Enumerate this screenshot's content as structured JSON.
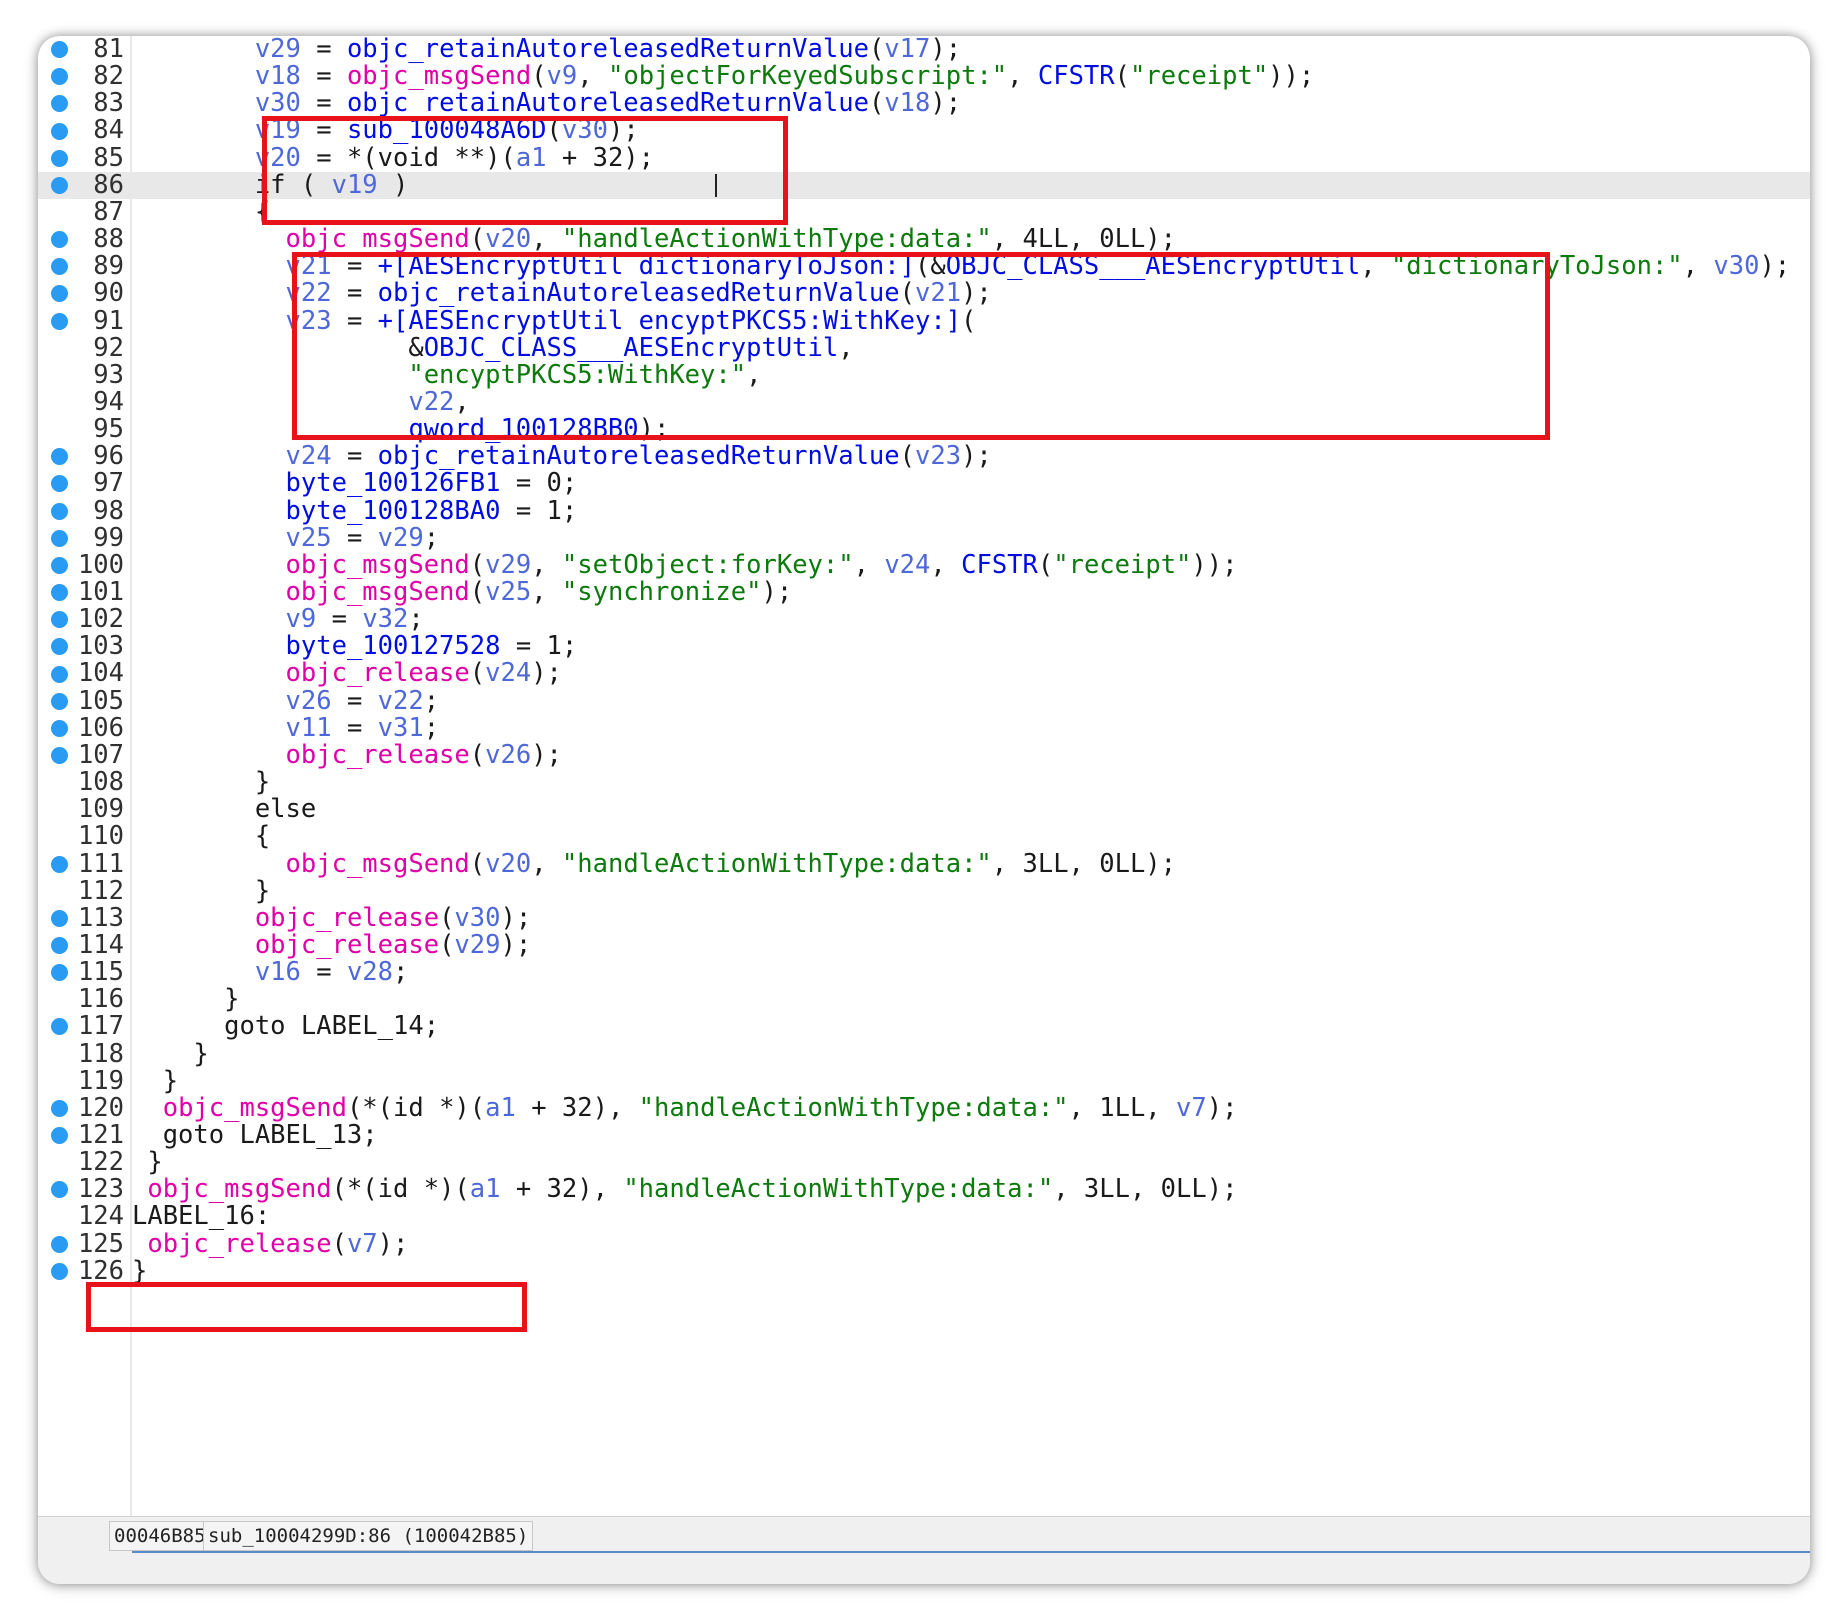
{
  "code": {
    "current_line": 86,
    "lines": [
      {
        "n": "81",
        "bp": true,
        "html": "        <span class=\"v\">v29</span> = <span class=\"f\">objc_retainAutoreleasedReturnValue</span>(<span class=\"v\">v17</span>);"
      },
      {
        "n": "82",
        "bp": true,
        "html": "        <span class=\"v\">v18</span> = <span class=\"m\">objc_msgSend</span>(<span class=\"v\">v9</span>, <span class=\"s\">\"objectForKeyedSubscript:\"</span>, <span class=\"f\">CFSTR</span>(<span class=\"s\">\"receipt\"</span>));"
      },
      {
        "n": "83",
        "bp": true,
        "html": "        <span class=\"v\">v30</span> = <span class=\"f\">objc_retainAutoreleasedReturnValue</span>(<span class=\"v\">v18</span>);"
      },
      {
        "n": "84",
        "bp": true,
        "html": "        <span class=\"v\">v19</span> = <span class=\"f\">sub_100048A6D</span>(<span class=\"v\">v30</span>);"
      },
      {
        "n": "85",
        "bp": true,
        "html": "        <span class=\"v\">v20</span> = *(void **)(<span class=\"v\">a1</span> + 32);"
      },
      {
        "n": "86",
        "bp": true,
        "html": "        if ( <span class=\"v\">v19</span> )"
      },
      {
        "n": "87",
        "bp": false,
        "html": "        {"
      },
      {
        "n": "88",
        "bp": true,
        "html": "          <span class=\"m\">objc_msgSend</span>(<span class=\"v\">v20</span>, <span class=\"s\">\"handleActionWithType:data:\"</span>, 4LL, 0LL);"
      },
      {
        "n": "89",
        "bp": true,
        "html": "          <span class=\"v\">v21</span> = <span class=\"f\">+[AESEncryptUtil dictionaryToJson:]</span>(&amp;<span class=\"f\">OBJC_CLASS___AESEncryptUtil</span>, <span class=\"s\">\"dictionaryToJson:\"</span>, <span class=\"v\">v30</span>);"
      },
      {
        "n": "90",
        "bp": true,
        "html": "          <span class=\"v\">v22</span> = <span class=\"f\">objc_retainAutoreleasedReturnValue</span>(<span class=\"v\">v21</span>);"
      },
      {
        "n": "91",
        "bp": true,
        "html": "          <span class=\"v\">v23</span> = <span class=\"f\">+[AESEncryptUtil encyptPKCS5:WithKey:]</span>("
      },
      {
        "n": "92",
        "bp": false,
        "html": "                  &amp;<span class=\"f\">OBJC_CLASS___AESEncryptUtil</span>,"
      },
      {
        "n": "93",
        "bp": false,
        "html": "                  <span class=\"s\">\"encyptPKCS5:WithKey:\"</span>,"
      },
      {
        "n": "94",
        "bp": false,
        "html": "                  <span class=\"v\">v22</span>,"
      },
      {
        "n": "95",
        "bp": false,
        "html": "                  <span class=\"f\">qword_100128BB0</span>);"
      },
      {
        "n": "96",
        "bp": true,
        "html": "          <span class=\"v\">v24</span> = <span class=\"f\">objc_retainAutoreleasedReturnValue</span>(<span class=\"v\">v23</span>);"
      },
      {
        "n": "97",
        "bp": true,
        "html": "          <span class=\"f\">byte_100126FB1</span> = 0;"
      },
      {
        "n": "98",
        "bp": true,
        "html": "          <span class=\"f\">byte_100128BA0</span> = 1;"
      },
      {
        "n": "99",
        "bp": true,
        "html": "          <span class=\"v\">v25</span> = <span class=\"v\">v29</span>;"
      },
      {
        "n": "100",
        "bp": true,
        "html": "          <span class=\"m\">objc_msgSend</span>(<span class=\"v\">v29</span>, <span class=\"s\">\"setObject:forKey:\"</span>, <span class=\"v\">v24</span>, <span class=\"f\">CFSTR</span>(<span class=\"s\">\"receipt\"</span>));"
      },
      {
        "n": "101",
        "bp": true,
        "html": "          <span class=\"m\">objc_msgSend</span>(<span class=\"v\">v25</span>, <span class=\"s\">\"synchronize\"</span>);"
      },
      {
        "n": "102",
        "bp": true,
        "html": "          <span class=\"v\">v9</span> = <span class=\"v\">v32</span>;"
      },
      {
        "n": "103",
        "bp": true,
        "html": "          <span class=\"f\">byte_100127528</span> = 1;"
      },
      {
        "n": "104",
        "bp": true,
        "html": "          <span class=\"m\">objc_release</span>(<span class=\"v\">v24</span>);"
      },
      {
        "n": "105",
        "bp": true,
        "html": "          <span class=\"v\">v26</span> = <span class=\"v\">v22</span>;"
      },
      {
        "n": "106",
        "bp": true,
        "html": "          <span class=\"v\">v11</span> = <span class=\"v\">v31</span>;"
      },
      {
        "n": "107",
        "bp": true,
        "html": "          <span class=\"m\">objc_release</span>(<span class=\"v\">v26</span>);"
      },
      {
        "n": "108",
        "bp": false,
        "html": "        }"
      },
      {
        "n": "109",
        "bp": false,
        "html": "        else"
      },
      {
        "n": "110",
        "bp": false,
        "html": "        {"
      },
      {
        "n": "111",
        "bp": true,
        "html": "          <span class=\"m\">objc_msgSend</span>(<span class=\"v\">v20</span>, <span class=\"s\">\"handleActionWithType:data:\"</span>, 3LL, 0LL);"
      },
      {
        "n": "112",
        "bp": false,
        "html": "        }"
      },
      {
        "n": "113",
        "bp": true,
        "html": "        <span class=\"m\">objc_release</span>(<span class=\"v\">v30</span>);"
      },
      {
        "n": "114",
        "bp": true,
        "html": "        <span class=\"m\">objc_release</span>(<span class=\"v\">v29</span>);"
      },
      {
        "n": "115",
        "bp": true,
        "html": "        <span class=\"v\">v16</span> = <span class=\"v\">v28</span>;"
      },
      {
        "n": "116",
        "bp": false,
        "html": "      }"
      },
      {
        "n": "117",
        "bp": true,
        "html": "      goto LABEL_14;"
      },
      {
        "n": "118",
        "bp": false,
        "html": "    }"
      },
      {
        "n": "119",
        "bp": false,
        "html": "  }"
      },
      {
        "n": "120",
        "bp": true,
        "html": "  <span class=\"m\">objc_msgSend</span>(*(id *)(<span class=\"v\">a1</span> + 32), <span class=\"s\">\"handleActionWithType:data:\"</span>, 1LL, <span class=\"v\">v7</span>);"
      },
      {
        "n": "121",
        "bp": true,
        "html": "  goto LABEL_13;"
      },
      {
        "n": "122",
        "bp": false,
        "html": " }"
      },
      {
        "n": "123",
        "bp": true,
        "html": " <span class=\"m\">objc_msgSend</span>(*(id *)(<span class=\"v\">a1</span> + 32), <span class=\"s\">\"handleActionWithType:data:\"</span>, 3LL, 0LL);"
      },
      {
        "n": "124",
        "bp": false,
        "html": "LABEL_16:"
      },
      {
        "n": "125",
        "bp": true,
        "html": " <span class=\"m\">objc_release</span>(<span class=\"v\">v7</span>);"
      },
      {
        "n": "126",
        "bp": true,
        "html": "}"
      }
    ]
  },
  "status_bar": {
    "address": "00046B85",
    "location": "sub_10004299D:86 (100042B85)"
  },
  "colors": {
    "variable": "#4f68d8",
    "function": "#000ce0",
    "msgsend": "#e000a8",
    "string": "#0c7a0c",
    "breakpoint_dot": "#2a9bf2",
    "highlight_box": "#e8121a"
  }
}
